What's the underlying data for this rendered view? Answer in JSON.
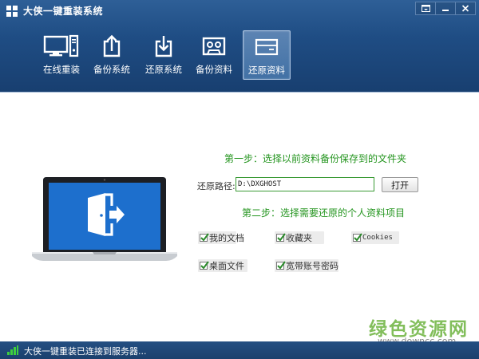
{
  "window": {
    "title": "大侠一键重装系统",
    "controls": [
      "menu-icon",
      "minimize-icon",
      "close-icon"
    ]
  },
  "toolbar": {
    "tabs": [
      {
        "label": "在线重装",
        "icon": "monitor-pc-icon",
        "active": false
      },
      {
        "label": "备份系统",
        "icon": "upload-tray-icon",
        "active": false
      },
      {
        "label": "还原系统",
        "icon": "download-tray-icon",
        "active": false
      },
      {
        "label": "备份资料",
        "icon": "cassette-tape-icon",
        "active": false
      },
      {
        "label": "还原资料",
        "icon": "window-card-icon",
        "active": true
      }
    ]
  },
  "main": {
    "illustration": "laptop-door-exit-icon",
    "step1": "第一步：选择以前资料备份保存到的文件夹",
    "path_label": "还原路径:",
    "path_value": "D:\\DXGHOST",
    "open_button": "打开",
    "step2": "第二步：选择需要还原的个人资料项目",
    "options": [
      {
        "label": "我的文档",
        "checked": true
      },
      {
        "label": "收藏夹",
        "checked": true
      },
      {
        "label": "Cookies",
        "checked": true
      },
      {
        "label": "桌面文件",
        "checked": true
      },
      {
        "label": "宽带账号密码",
        "checked": true
      }
    ]
  },
  "watermark": {
    "main": "绿色资源网",
    "url": "www.downcc.com"
  },
  "status": {
    "text": "大侠一键重装已连接到服务器...",
    "icon": "signal-bars-icon"
  },
  "colors": {
    "header": "#1f4d84",
    "accent_green": "#24951f",
    "status_bar": "#1f4878"
  }
}
